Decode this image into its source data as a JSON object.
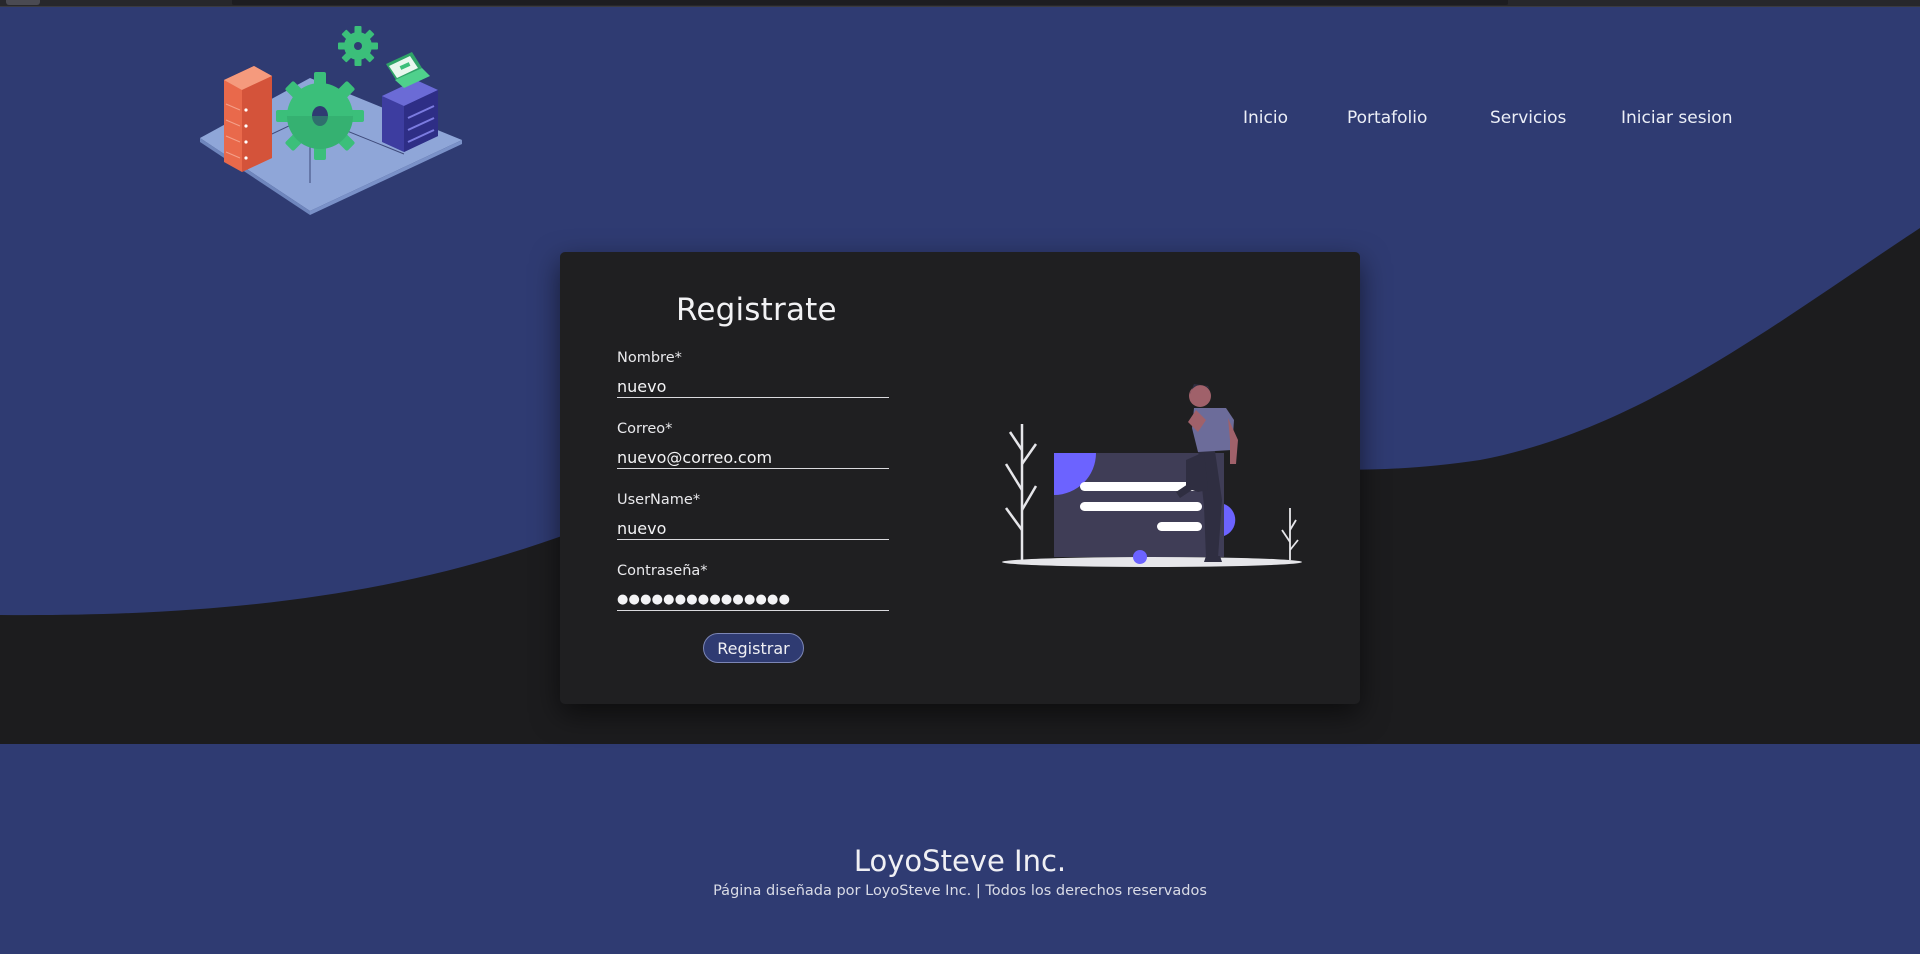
{
  "nav": {
    "items": [
      {
        "label": "Inicio"
      },
      {
        "label": "Portafolio"
      },
      {
        "label": "Servicios"
      },
      {
        "label": "Iniciar sesion"
      }
    ]
  },
  "form": {
    "title": "Registrate",
    "fields": [
      {
        "label": "Nombre*",
        "value": "nuevo"
      },
      {
        "label": "Correo*",
        "value": "nuevo@correo.com"
      },
      {
        "label": "UserName*",
        "value": "nuevo"
      },
      {
        "label": "Contraseña*",
        "value": "●●●●●●●●●●●●●●●"
      }
    ],
    "submit_label": "Registrar"
  },
  "footer": {
    "brand": "LoyoSteve Inc.",
    "credits": "Página diseñada por LoyoSteve Inc. | Todos los derechos reservados"
  },
  "colors": {
    "brand_blue": "#2f3b72",
    "dark_band": "#1c1c1e",
    "card_bg": "#1f1f21",
    "accent_purple": "#6c63ff"
  },
  "icons": [
    "server-isometric-logo",
    "person-thinking-illustration"
  ]
}
